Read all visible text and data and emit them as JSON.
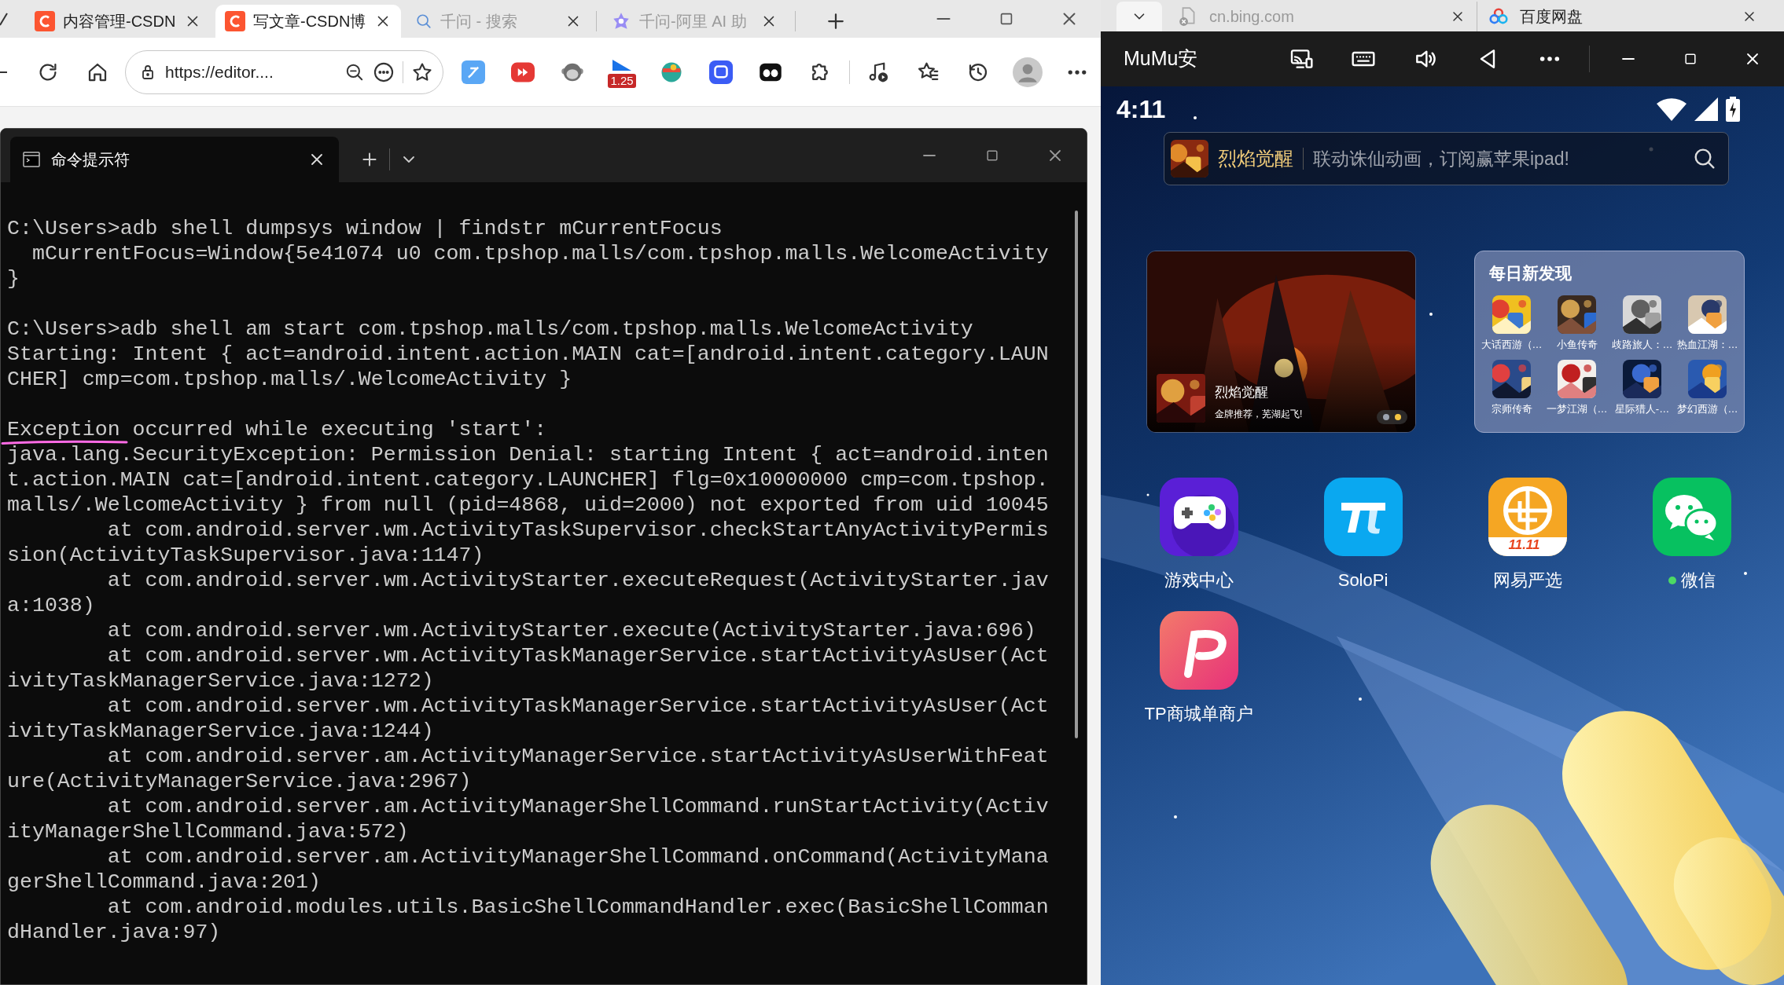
{
  "browser": {
    "tabs": [
      {
        "title": "内容管理-CSDN",
        "kind": "csdn",
        "selected": false,
        "dimmed": false
      },
      {
        "title": "写文章-CSDN博",
        "kind": "csdn",
        "selected": true,
        "dimmed": false
      },
      {
        "title": "千问 - 搜索",
        "kind": "search",
        "selected": false,
        "dimmed": true
      },
      {
        "title": "千问-阿里 AI 助",
        "kind": "sparkle",
        "selected": false,
        "dimmed": true
      }
    ],
    "address": "https://editor....",
    "extension_badge": "1.25"
  },
  "terminal": {
    "tab_title": "命令提示符",
    "blocks": [
      [
        "C:\\Users>adb shell dumpsys window | findstr mCurrentFocus",
        "  mCurrentFocus=Window{5e41074 u0 com.tpshop.malls/com.tpshop.malls.WelcomeActivity",
        "}"
      ],
      [
        "C:\\Users>adb shell am start com.tpshop.malls/com.tpshop.malls.WelcomeActivity",
        "Starting: Intent { act=android.intent.action.MAIN cat=[android.intent.category.LAUN",
        "CHER] cmp=com.tpshop.malls/.WelcomeActivity }"
      ],
      [
        "Exception occurred while executing 'start':",
        "java.lang.SecurityException: Permission Denial: starting Intent { act=android.inten",
        "t.action.MAIN cat=[android.intent.category.LAUNCHER] flg=0x10000000 cmp=com.tpshop.",
        "malls/.WelcomeActivity } from null (pid=4868, uid=2000) not exported from uid 10045",
        "        at com.android.server.wm.ActivityTaskSupervisor.checkStartAnyActivityPermis",
        "sion(ActivityTaskSupervisor.java:1147)",
        "        at com.android.server.wm.ActivityStarter.executeRequest(ActivityStarter.jav",
        "a:1038)",
        "        at com.android.server.wm.ActivityStarter.execute(ActivityStarter.java:696)",
        "        at com.android.server.wm.ActivityTaskManagerService.startActivityAsUser(Act",
        "ivityTaskManagerService.java:1272)",
        "        at com.android.server.wm.ActivityTaskManagerService.startActivityAsUser(Act",
        "ivityTaskManagerService.java:1244)",
        "        at com.android.server.am.ActivityManagerService.startActivityAsUserWithFeat",
        "ure(ActivityManagerService.java:2967)",
        "        at com.android.server.am.ActivityManagerShellCommand.runStartActivity(Activ",
        "ityManagerShellCommand.java:572)",
        "        at com.android.server.am.ActivityManagerShellCommand.onCommand(ActivityMana",
        "gerShellCommand.java:201)",
        "        at com.android.modules.utils.BasicShellCommandHandler.exec(BasicShellComman",
        "dHandler.java:97)"
      ]
    ]
  },
  "emulator": {
    "browser_tabs": [
      {
        "title": "cn.bing.com",
        "kind": "error",
        "dimmed": true
      },
      {
        "title": "百度网盘",
        "kind": "cloud",
        "dimmed": false
      }
    ],
    "title": "MuMu安",
    "time": "4:11",
    "search": {
      "game": "烈焰觉醒",
      "text": "联动诛仙动画，订阅赢苹果ipad!"
    },
    "banner": {
      "title": "烈焰觉醒",
      "subtitle": "金牌推荐，芜湖起飞!",
      "pager": [
        {
          "selected": false
        },
        {
          "selected": true
        }
      ]
    },
    "discovery": {
      "title": "每日新发现",
      "games": [
        "大话西游（…",
        "小鱼传奇",
        "歧路旅人：…",
        "热血江湖：…",
        "宗师传奇",
        "一梦江湖（…",
        "星际猎人-…",
        "梦幻西游（…"
      ]
    },
    "apps": [
      {
        "label": "游戏中心",
        "kind": "gamepad",
        "notification": false
      },
      {
        "label": "SoloPi",
        "kind": "pi",
        "notification": false
      },
      {
        "label": "网易严选",
        "kind": "shop",
        "badge": "11.11",
        "notification": false
      },
      {
        "label": "微信",
        "kind": "chat",
        "notification": true
      },
      {
        "label": "TP商城单商户",
        "kind": "p",
        "notification": false
      }
    ]
  }
}
